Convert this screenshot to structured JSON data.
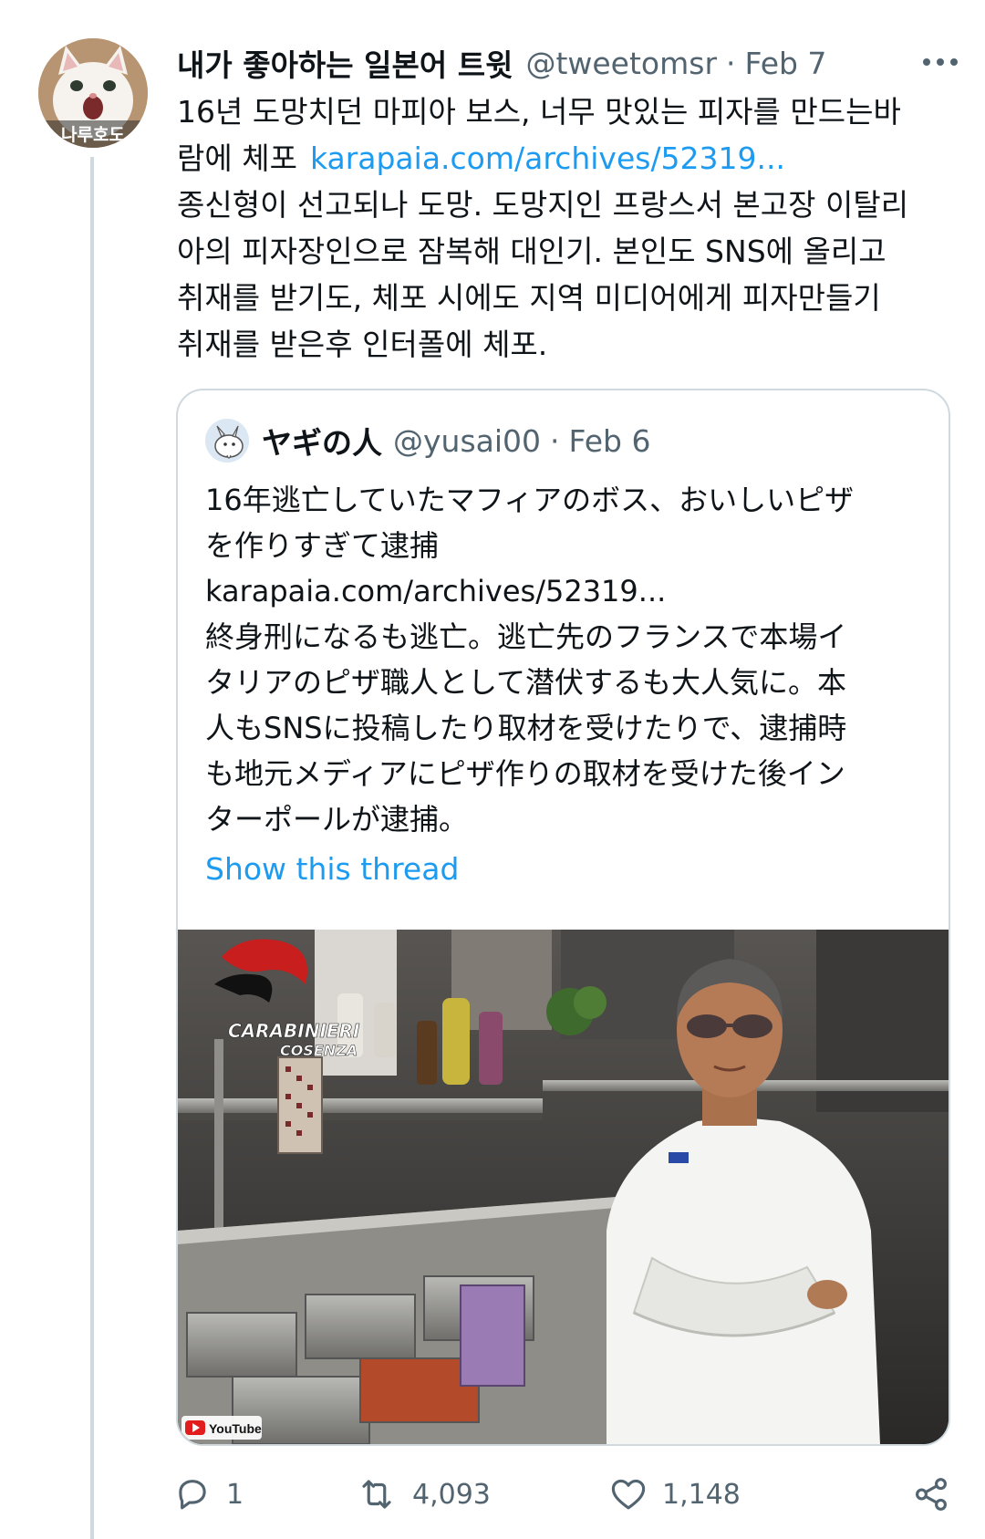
{
  "tweet": {
    "avatar_label": "나루호도",
    "display_name": "내가 좋아하는 일본어 트윗",
    "handle": "@tweetomsr",
    "separator": "·",
    "date": "Feb 7",
    "text_lines": [
      "16년 도망치던 마피아 보스, 너무 맛있는 피자를 만드는바",
      "람에 체포",
      "종신형이 선고되나 도망. 도망지인 프랑스서 본고장 이탈리",
      "아의 피자장인으로 잠복해 대인기. 본인도 SNS에 올리고",
      "취재를 받기도, 체포 시에도 지역 미디어에게 피자만들기",
      "취재를 받은후 인터폴에 체포."
    ],
    "link": "karapaia.com/archives/52319..."
  },
  "quote": {
    "display_name": "ヤギの人",
    "handle": "@yusai00",
    "separator": "·",
    "date": "Feb 6",
    "text_lines": [
      "16年逃亡していたマフィアのボス、おいしいピザ",
      "を作りすぎて逮捕",
      "karapaia.com/archives/52319...",
      "終身刑になるも逃亡。逃亡先のフランスで本場イ",
      "タリアのピザ職人として潜伏するも大人気に。本",
      "人もSNSに投稿したり取材を受けたりで、逮捕時",
      "も地元メディアにピザ作りの取材を受けた後イン",
      "ターポールが逮捕。"
    ],
    "show_thread": "Show this thread",
    "image": {
      "watermark_top": "CARABINIERI",
      "watermark_bottom": "COSENZA",
      "youtube_label": "YouTube"
    }
  },
  "actions": {
    "replies": "1",
    "retweets": "4,093",
    "likes": "1,148"
  },
  "colors": {
    "link": "#1d9bf0",
    "secondary_text": "#536471",
    "border": "#cfd9de"
  }
}
